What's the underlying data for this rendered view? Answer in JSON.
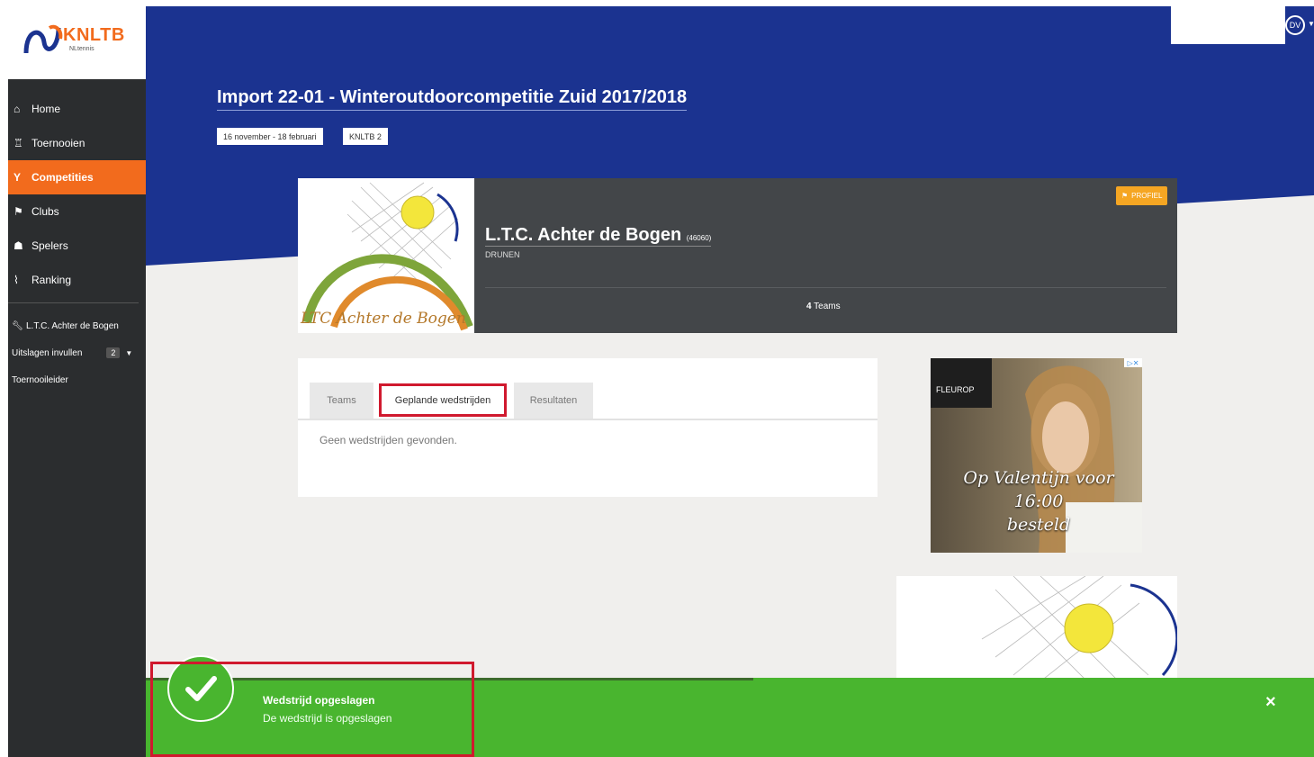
{
  "brand": {
    "name": "KNLTB",
    "sub": "NLtennis"
  },
  "sidebar": {
    "items": [
      {
        "icon": "home-icon",
        "glyph": "⌂",
        "label": "Home"
      },
      {
        "icon": "trophy-icon",
        "glyph": "♖",
        "label": "Toernooien"
      },
      {
        "icon": "cup-icon",
        "glyph": "Y",
        "label": "Competities"
      },
      {
        "icon": "flag-icon",
        "glyph": "⚑",
        "label": "Clubs"
      },
      {
        "icon": "users-icon",
        "glyph": "☗",
        "label": "Spelers"
      },
      {
        "icon": "chart-icon",
        "glyph": "⌇",
        "label": "Ranking"
      }
    ],
    "club_link": "L.T.C. Achter de Bogen",
    "results_label": "Uitslagen invullen",
    "results_badge": "2",
    "organizer_label": "Toernooileider"
  },
  "header": {
    "title": "Import 22-01 - Winteroutdoorcompetitie Zuid 2017/2018",
    "tags": [
      "16 november - 18 februari",
      "KNLTB 2"
    ],
    "avatar": "DV"
  },
  "club": {
    "name": "L.T.C. Achter de Bogen",
    "code": "(46060)",
    "city": "DRUNEN",
    "teams_count": "4",
    "teams_label": "Teams",
    "profile_button": "PROFIEL",
    "logo_text": "LTC Achter de Bogen"
  },
  "tabs": {
    "items": [
      "Teams",
      "Geplande wedstrijden",
      "Resultaten"
    ],
    "active": "Geplande wedstrijden",
    "empty_message": "Geen wedstrijden gevonden."
  },
  "ad": {
    "brand": "FLEUROP",
    "slogan_line1": "Op Valentijn voor 16:00",
    "slogan_line2": "besteld"
  },
  "toast": {
    "title": "Wedstrijd opgeslagen",
    "message": "De wedstrijd is opgeslagen",
    "close": "×",
    "progress": 0.52
  },
  "colors": {
    "hero_blue": "#1b3390",
    "accent_orange": "#f26b1d",
    "success_green": "#49b52f",
    "highlight_red": "#d0192e"
  }
}
